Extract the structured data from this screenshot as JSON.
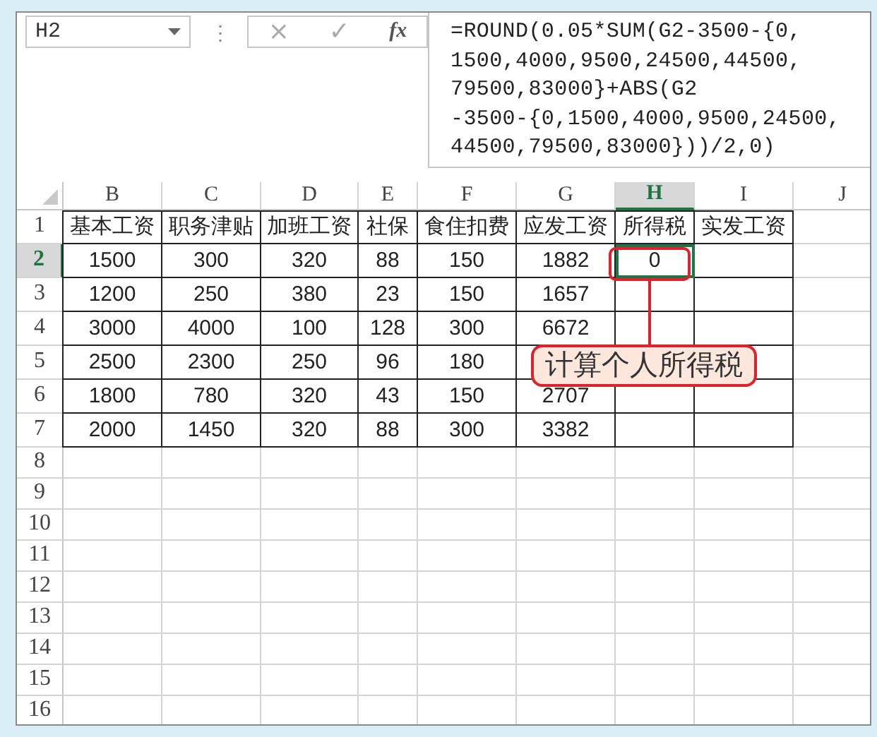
{
  "formula_bar": {
    "name_box": "H2",
    "more": "⋮",
    "cancel": "×",
    "enter": "✓",
    "function": "fx",
    "formula_lines": [
      "=ROUND(0.05*SUM(G2-3500-{0,",
      "1500,4000,9500,24500,44500,",
      "79500,83000}+ABS(G2",
      "-3500-{0,1500,4000,9500,24500,",
      "44500,79500,83000}))/2,0)"
    ]
  },
  "sheet": {
    "columns": [
      {
        "label": "B",
        "selected": false
      },
      {
        "label": "C",
        "selected": false
      },
      {
        "label": "D",
        "selected": false
      },
      {
        "label": "E",
        "selected": false
      },
      {
        "label": "F",
        "selected": false
      },
      {
        "label": "G",
        "selected": false
      },
      {
        "label": "H",
        "selected": true
      },
      {
        "label": "I",
        "selected": false
      },
      {
        "label": "J",
        "selected": false
      }
    ],
    "rows": [
      {
        "number": "1",
        "selected": false,
        "cells": [
          "基本工资",
          "职务津贴",
          "加班工资",
          "社保",
          "食住扣费",
          "应发工资",
          "所得税",
          "实发工资"
        ]
      },
      {
        "number": "2",
        "selected": true,
        "cells": [
          "1500",
          "300",
          "320",
          "88",
          "150",
          "1882",
          "0",
          null
        ]
      },
      {
        "number": "3",
        "selected": false,
        "cells": [
          "1200",
          "250",
          "380",
          "23",
          "150",
          "1657",
          null,
          null
        ]
      },
      {
        "number": "4",
        "selected": false,
        "cells": [
          "3000",
          "4000",
          "100",
          "128",
          "300",
          "6672",
          null,
          null
        ]
      },
      {
        "number": "5",
        "selected": false,
        "cells": [
          "2500",
          "2300",
          "250",
          "96",
          "180",
          null,
          null,
          null
        ]
      },
      {
        "number": "6",
        "selected": false,
        "cells": [
          "1800",
          "780",
          "320",
          "43",
          "150",
          "2707",
          null,
          null
        ]
      },
      {
        "number": "7",
        "selected": false,
        "cells": [
          "2000",
          "1450",
          "320",
          "88",
          "300",
          "3382",
          null,
          null
        ]
      },
      {
        "number": "8",
        "selected": false
      },
      {
        "number": "9",
        "selected": false
      },
      {
        "number": "10",
        "selected": false
      },
      {
        "number": "11",
        "selected": false
      },
      {
        "number": "12",
        "selected": false
      },
      {
        "number": "13",
        "selected": false
      },
      {
        "number": "14",
        "selected": false
      },
      {
        "number": "15",
        "selected": false
      },
      {
        "number": "16",
        "selected": false
      }
    ]
  },
  "callout": {
    "text": "计算个人所得税"
  }
}
